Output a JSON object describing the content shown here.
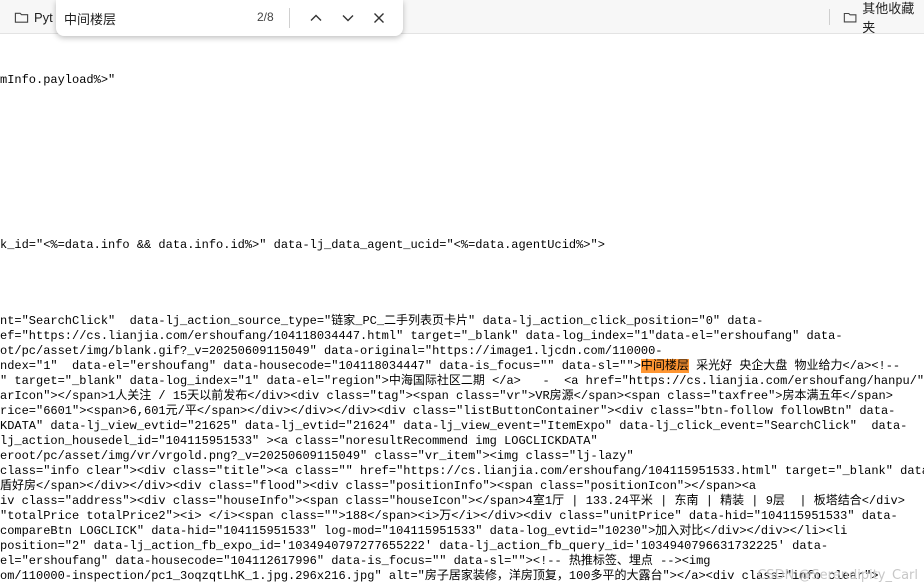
{
  "bookmarks": {
    "left_label": "Pyt",
    "right_label": "其他收藏夹"
  },
  "find": {
    "query": "中间楼层",
    "count": "2/8"
  },
  "source_lines": [
    "mInfo.payload%>\"",
    "k_id=\"<%=data.info && data.info.id%>\" data-lj_data_agent_ucid=\"<%=data.agentUcid%>\">",
    "nt=\"SearchClick\"  data-lj_action_source_type=\"链家_PC_二手列表页卡片\" data-lj_action_click_position=\"0\" data-",
    "ef=\"https://cs.lianjia.com/ershoufang/104118034447.html\" target=\"_blank\" data-log_index=\"1\"data-el=\"ershoufang\" data-",
    "ot/pc/asset/img/blank.gif?_v=20250609115049\" data-original=\"https://image1.ljcdn.com/110000-",
    "ndex=\"1\"  data-el=\"ershoufang\" data-housecode=\"104118034447\" data-is_focus=\"\" data-sl=\"\">中间楼层 采光好 央企大盘 物业给力</a><!--",
    "\" target=\"_blank\" data-log_index=\"1\" data-el=\"region\">中海国际社区二期 </a>   -  <a href=\"https://cs.lianjia.com/ershoufang/hanpu/\"",
    "arIcon\"></span>1人关注 / 15天以前发布</div><div class=\"tag\"><span class=\"vr\">VR房源</span><span class=\"taxfree\">房本满五年</span>",
    "rice=\"6601\"><span>6,601元/平</span></div></div></div><div class=\"listButtonContainer\"><div class=\"btn-follow followBtn\" data-",
    "KDATA\" data-lj_view_evtid=\"21625\" data-lj_evtid=\"21624\" data-lj_view_event=\"ItemExpo\" data-lj_click_event=\"SearchClick\"  data-",
    "lj_action_housedel_id=\"104115951533\" ><a class=\"noresultRecommend img LOGCLICKDATA\"",
    "eroot/pc/asset/img/vr/vrgold.png?_v=20250609115049\" class=\"vr_item\"><img class=\"lj-lazy\"",
    "class=\"info clear\"><div class=\"title\"><a class=\"\" href=\"https://cs.lianjia.com/ershoufang/104115951533.html\" target=\"_blank\" data-",
    "盾好房</span></div></div><div class=\"flood\"><div class=\"positionInfo\"><span class=\"positionIcon\"></span><a",
    "iv class=\"address\"><div class=\"houseInfo\"><span class=\"houseIcon\"></span>4室1厅 | 133.24平米 | 东南 | 精装 | 9层  | 板塔结合</div>",
    "\"totalPrice totalPrice2\"><i> </i><span class=\"\">188</span><i>万</i></div><div class=\"unitPrice\" data-hid=\"104115951533\" data-",
    "compareBtn LOGCLICK\" data-hid=\"104115951533\" log-mod=\"104115951533\" data-log_evtid=\"10230\">加入对比</div></div></li><li",
    "position=\"2\" data-lj_action_fb_expo_id='1034940797277655222' data-lj_action_fb_query_id='1034940796631732225' data-",
    "el=\"ershoufang\" data-housecode=\"104112617996\" data-is_focus=\"\" data-sl=\"\"><!-- 热推标签、埋点 --><img",
    "om/110000-inspection/pc1_3oqzqtLhK_1.jpg.296x216.jpg\" alt=\"房子居家装修，洋房顶复，100多平的大露台\"></a><div class=\"info clear\">"
  ],
  "watermark": "CSDN @Serendipity_Carl"
}
